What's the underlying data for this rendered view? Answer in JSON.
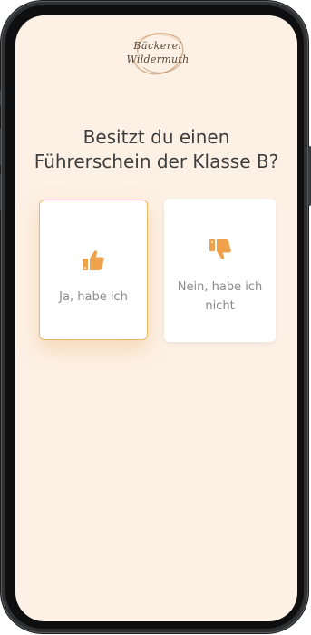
{
  "brand": {
    "logo_line1": "Bäckerei",
    "logo_line2": "Wildermuth"
  },
  "question": {
    "line1": "Besitzt du einen",
    "line2": "Führerschein der Klasse B?"
  },
  "options": [
    {
      "label": "Ja, habe ich",
      "icon": "thumbs-up-icon",
      "selected": true
    },
    {
      "label": "Nein, habe ich nicht",
      "icon": "thumbs-down-icon",
      "selected": false
    }
  ],
  "colors": {
    "background": "#fdf1e6",
    "accent": "#f0a24a",
    "selected_border": "#e8b865",
    "text": "#3d3d3d",
    "muted_text": "#8a8a8a"
  }
}
